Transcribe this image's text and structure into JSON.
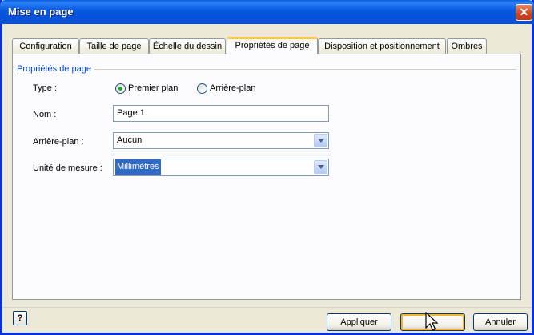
{
  "window": {
    "title": "Mise en page",
    "close_glyph": "✕"
  },
  "tabs": [
    {
      "label": "Configuration"
    },
    {
      "label": "Taille de page"
    },
    {
      "label": "Échelle du dessin"
    },
    {
      "label": "Propriétés de page"
    },
    {
      "label": "Disposition et positionnement"
    },
    {
      "label": "Ombres"
    }
  ],
  "active_tab": "Propriétés de page",
  "group": {
    "label": "Propriétés de page"
  },
  "type": {
    "label": "Type :",
    "options": [
      {
        "label": "Premier plan",
        "checked": true
      },
      {
        "label": "Arrière-plan",
        "checked": false
      }
    ]
  },
  "name": {
    "label": "Nom :",
    "value": "Page 1"
  },
  "background": {
    "label": "Arrière-plan :",
    "value": "Aucun"
  },
  "unit": {
    "label": "Unité de mesure :",
    "value": "Millimètres"
  },
  "help_glyph": "?",
  "buttons": {
    "apply": "Appliquer",
    "ok": "OK",
    "cancel": "Annuler"
  },
  "colors": {
    "titlebar": "#0a5fdf",
    "active_tab_accent": "#ffc83c",
    "selection": "#316ac5",
    "radio_check": "#21a121"
  }
}
